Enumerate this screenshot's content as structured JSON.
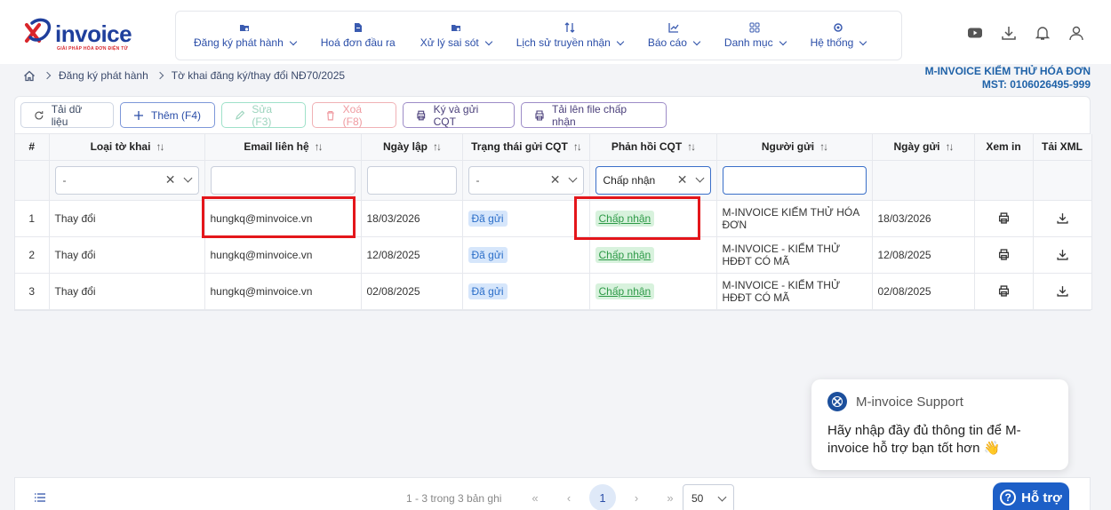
{
  "brand": {
    "logo_text": "invoice",
    "logo_sub": "GIẢI PHÁP HÓA ĐƠN ĐIỆN TỬ",
    "accent": "#2b4ea8",
    "logo_red": "#d9262b"
  },
  "nav": {
    "items": [
      {
        "label": "Đăng ký phát hành",
        "icon": "folder-lock-icon",
        "has_dropdown": true
      },
      {
        "label": "Hoá đơn đầu ra",
        "icon": "document-icon",
        "has_dropdown": false
      },
      {
        "label": "Xử lý sai sót",
        "icon": "folder-lock-icon",
        "has_dropdown": true
      },
      {
        "label": "Lịch sử truyền nhận",
        "icon": "arrows-updown-icon",
        "has_dropdown": true
      },
      {
        "label": "Báo cáo",
        "icon": "chart-line-icon",
        "has_dropdown": true
      },
      {
        "label": "Danh mục",
        "icon": "grid-icon",
        "has_dropdown": true
      },
      {
        "label": "Hệ thống",
        "icon": "gear-icon",
        "has_dropdown": true
      }
    ]
  },
  "top_icons": [
    "youtube-icon",
    "download-icon",
    "bell-icon",
    "user-icon"
  ],
  "breadcrumb": {
    "items": [
      "Đăng ký phát hành",
      "Tờ khai đăng ký/thay đổi NĐ70/2025"
    ]
  },
  "company": {
    "name": "M-INVOICE KIỂM THỬ HÓA ĐƠN",
    "tax_code": "MST: 0106026495-999"
  },
  "toolbar": {
    "reload": "Tải dữ liệu",
    "add": "Thêm (F4)",
    "edit": "Sửa (F3)",
    "delete": "Xoá (F8)",
    "sign_send": "Ký và gửi CQT",
    "upload": "Tải lên file chấp nhận"
  },
  "table": {
    "columns": [
      "#",
      "Loại tờ khai",
      "Email liên hệ",
      "Ngày lập",
      "Trạng thái gửi CQT",
      "Phản hồi CQT",
      "Người gửi",
      "Ngày gửi",
      "Xem in",
      "Tải XML"
    ],
    "filters": {
      "loai_to_khai": "-",
      "trang_thai": "-",
      "phan_hoi": "Chấp nhận"
    },
    "rows": [
      {
        "no": "1",
        "type": "Thay đổi",
        "email": "hungkq@minvoice.vn",
        "created": "18/03/2026",
        "status": "Đã gửi",
        "response": "Chấp nhận",
        "sender": "M-INVOICE KIẾM THỬ HÓA ĐƠN",
        "sent": "18/03/2026"
      },
      {
        "no": "2",
        "type": "Thay đổi",
        "email": "hungkq@minvoice.vn",
        "created": "12/08/2025",
        "status": "Đã gửi",
        "response": "Chấp nhận",
        "sender": "M-INVOICE - KIỂM THỬ HĐĐT CÓ MÃ",
        "sent": "12/08/2025"
      },
      {
        "no": "3",
        "type": "Thay đổi",
        "email": "hungkq@minvoice.vn",
        "created": "02/08/2025",
        "status": "Đã gửi",
        "response": "Chấp nhận",
        "sender": "M-INVOICE - KIỂM THỬ HĐĐT CÓ MÃ",
        "sent": "02/08/2025"
      }
    ]
  },
  "pager": {
    "info": "1 - 3 trong 3 bản ghi",
    "first": "«",
    "prev": "‹",
    "current": "1",
    "next": "›",
    "last": "»",
    "page_size": "50"
  },
  "support": {
    "title": "M-invoice Support",
    "message": "Hãy nhập đầy đủ thông tin để M-invoice hỗ trợ bạn tốt hơn",
    "emoji": "👋",
    "help_label": "Hỗ trợ",
    "help_icon": "?"
  }
}
